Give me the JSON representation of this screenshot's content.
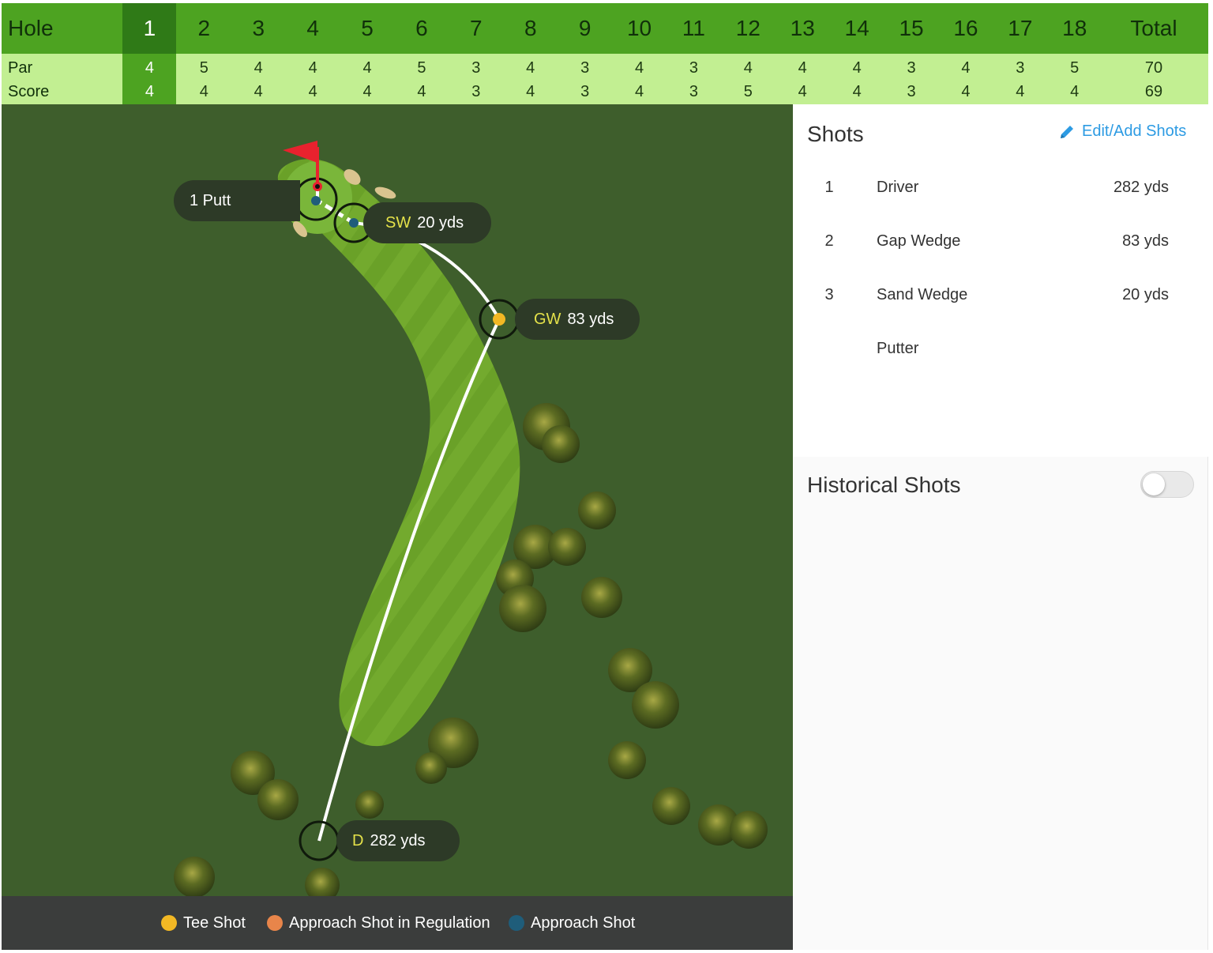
{
  "scorecard": {
    "header_label": "Hole",
    "par_label": "Par",
    "score_label": "Score",
    "total_label": "Total",
    "selected_hole": "1",
    "holes": [
      "1",
      "2",
      "3",
      "4",
      "5",
      "6",
      "7",
      "8",
      "9",
      "10",
      "11",
      "12",
      "13",
      "14",
      "15",
      "16",
      "17",
      "18"
    ],
    "par": [
      "4",
      "5",
      "4",
      "4",
      "4",
      "5",
      "3",
      "4",
      "3",
      "4",
      "3",
      "4",
      "4",
      "4",
      "3",
      "4",
      "3",
      "5"
    ],
    "score": [
      "4",
      "4",
      "4",
      "4",
      "4",
      "4",
      "3",
      "4",
      "3",
      "4",
      "3",
      "5",
      "4",
      "4",
      "3",
      "4",
      "4",
      "4"
    ],
    "par_total": "70",
    "score_total": "69",
    "colors": {
      "header": "#4da321",
      "selected": "#2f7a17",
      "body": "#c2ef92"
    }
  },
  "map": {
    "tags": {
      "putt": {
        "text": "1 Putt"
      },
      "sw": {
        "club": "SW",
        "distance": "20 yds"
      },
      "gw": {
        "club": "GW",
        "distance": "83 yds"
      },
      "d": {
        "club": "D",
        "distance": "282 yds"
      }
    },
    "flag_color": "#e8222e",
    "icons": [
      "flag-icon",
      "tee-marker",
      "ball-marker"
    ]
  },
  "legend": {
    "items": [
      {
        "label": "Tee Shot",
        "color": "#f2b824"
      },
      {
        "label": "Approach Shot in Regulation",
        "color": "#e8854a"
      },
      {
        "label": "Approach Shot",
        "color": "#1f5d7a"
      }
    ]
  },
  "shots": {
    "title": "Shots",
    "edit_label": "Edit/Add Shots",
    "edit_icon": "pencil-icon",
    "rows": [
      {
        "num": "1",
        "club": "Driver",
        "distance": "282 yds"
      },
      {
        "num": "2",
        "club": "Gap Wedge",
        "distance": "83 yds"
      },
      {
        "num": "3",
        "club": "Sand Wedge",
        "distance": "20 yds"
      },
      {
        "num": "",
        "club": "Putter",
        "distance": ""
      }
    ]
  },
  "historical": {
    "title": "Historical Shots",
    "enabled": false
  }
}
